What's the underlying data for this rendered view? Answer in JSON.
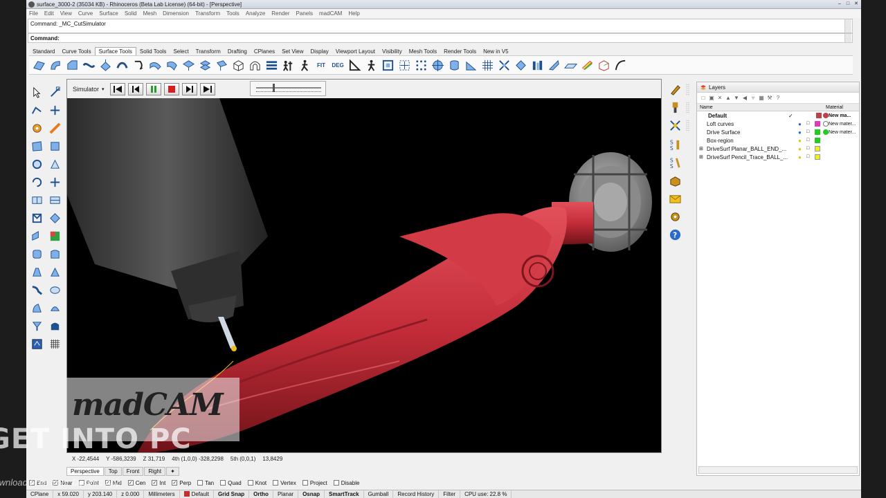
{
  "window": {
    "title": "surface_3000-2 (35034 KB) - Rhinoceros (Beta Lab License) (64-bit) - [Perspective]"
  },
  "menu": [
    "File",
    "Edit",
    "View",
    "Curve",
    "Surface",
    "Solid",
    "Mesh",
    "Dimension",
    "Transform",
    "Tools",
    "Analyze",
    "Render",
    "Panels",
    "madCAM",
    "Help"
  ],
  "command": {
    "history": "Command: _MC_CutSimulator",
    "prompt": "Command:"
  },
  "tabs": [
    "Standard",
    "Curve Tools",
    "Surface Tools",
    "Solid Tools",
    "Select",
    "Transform",
    "Drafting",
    "CPlanes",
    "Set View",
    "Display",
    "Viewport Layout",
    "Visibility",
    "Mesh Tools",
    "Render Tools",
    "New in V5"
  ],
  "active_tab": "Surface Tools",
  "toolbar_text": {
    "fit": "FIT",
    "deg": "DEG"
  },
  "simulator": {
    "label": "Simulator",
    "progress": 0.25
  },
  "coords": {
    "x": "X -22,4544",
    "y": "Y -586,3239",
    "z": "Z 31,719",
    "fourth": "4th (1,0,0) -328,2298",
    "fifth": "5th (0,0,1)",
    "fifth_val": "13,8429"
  },
  "viewport_tabs": [
    "Perspective",
    "Top",
    "Front",
    "Right"
  ],
  "osnap": [
    {
      "label": "End",
      "checked": true
    },
    {
      "label": "Near",
      "checked": true
    },
    {
      "label": "Point",
      "checked": false
    },
    {
      "label": "Mid",
      "checked": true
    },
    {
      "label": "Cen",
      "checked": true
    },
    {
      "label": "Int",
      "checked": true
    },
    {
      "label": "Perp",
      "checked": true
    },
    {
      "label": "Tan",
      "checked": false
    },
    {
      "label": "Quad",
      "checked": false
    },
    {
      "label": "Knot",
      "checked": false
    },
    {
      "label": "Vertex",
      "checked": false
    },
    {
      "label": "Project",
      "checked": false
    },
    {
      "label": "Disable",
      "checked": false
    }
  ],
  "status": {
    "cplane": "CPlane",
    "x": "x 59.020",
    "y": "y 203.140",
    "z": "z 0.000",
    "units": "Millimeters",
    "layer": "Default",
    "grid_snap": "Grid Snap",
    "ortho": "Ortho",
    "planar": "Planar",
    "osnap": "Osnap",
    "smarttrack": "SmartTrack",
    "gumball": "Gumball",
    "record_history": "Record History",
    "filter": "Filter",
    "cpu": "CPU use: 22.8 %"
  },
  "layers": {
    "title": "Layers",
    "col_name": "Name",
    "col_material": "Material",
    "rows": [
      {
        "name": "Default",
        "current": true,
        "check": "✓",
        "color": "#c0404a",
        "mat_color": "#c0404a",
        "material": "New ma..."
      },
      {
        "name": "Loft curves",
        "current": false,
        "check": "",
        "color": "#e03ab8",
        "mat_color": "#ffffff",
        "material": "New mater..."
      },
      {
        "name": "Drive Surface",
        "current": false,
        "check": "",
        "color": "#22cc22",
        "mat_color": "#22cc22",
        "material": "New mater..."
      },
      {
        "name": "Box-region",
        "current": false,
        "check": "",
        "color": "#22cc22",
        "mat_color": "",
        "material": ""
      },
      {
        "name": "DriveSurf Planar_BALL_END_...",
        "current": false,
        "check": "",
        "color": "#eeee22",
        "mat_color": "",
        "material": ""
      },
      {
        "name": "DriveSurf Pencil_Trace_BALL_...",
        "current": false,
        "check": "",
        "color": "#eeee22",
        "mat_color": "",
        "material": ""
      }
    ]
  },
  "watermark": {
    "logo": "madCAM",
    "site": "GET INTO PC",
    "download": "Download Free Your Desired App"
  },
  "colors": {
    "workpiece": "#c8313c",
    "viewport_bg": "#000000",
    "tool": "#3c3c3c"
  }
}
